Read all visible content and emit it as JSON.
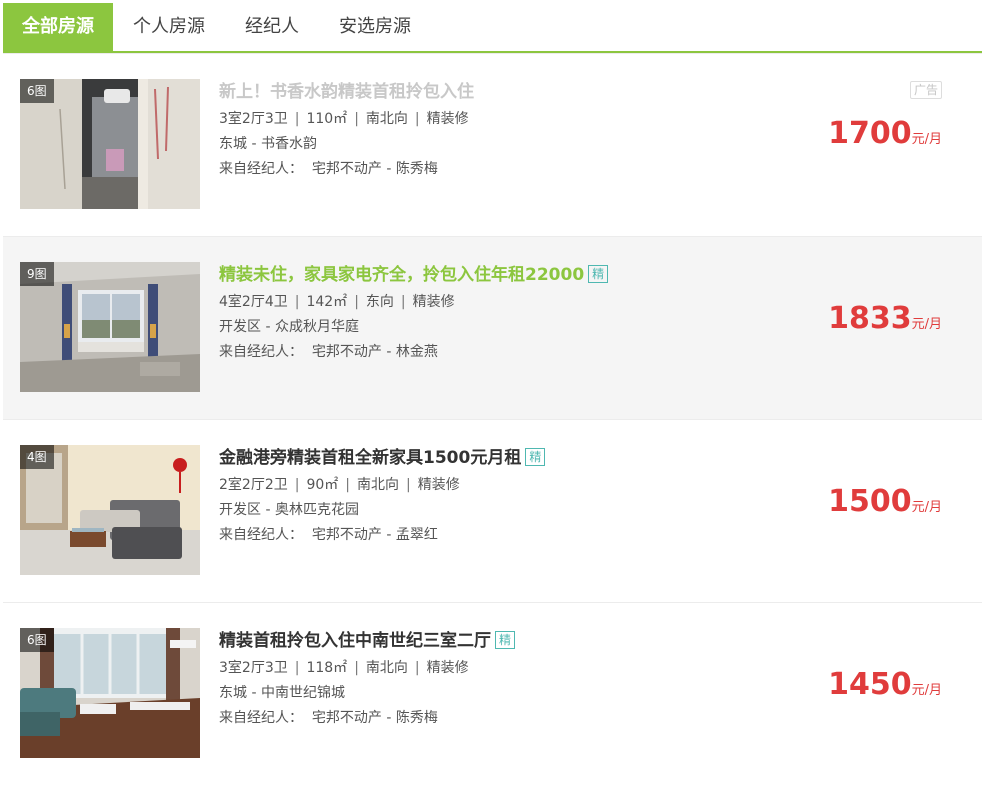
{
  "tabs": [
    {
      "label": "全部房源",
      "active": true
    },
    {
      "label": "个人房源",
      "active": false
    },
    {
      "label": "经纪人",
      "active": false
    },
    {
      "label": "安选房源",
      "active": false
    }
  ],
  "colors": {
    "accent": "#8cc63f",
    "price": "#e03c3c",
    "tag": "#4fb8b1"
  },
  "listings": [
    {
      "pic_count": "6图",
      "title": "新上！书香水韵精装首租拎包入住",
      "layout": "3室2厅3卫",
      "area": "110㎡",
      "orientation": "南北向",
      "decoration": "精装修",
      "district": "东城",
      "community": "书香水韵",
      "source_label": "来自经纪人：",
      "agency": "宅邦不动产",
      "agent": "陈秀梅",
      "ad_badge": "广告",
      "price": "1700",
      "price_unit": "元/月"
    },
    {
      "pic_count": "9图",
      "title": "精装未住，家具家电齐全，拎包入住年租22000",
      "tag": "精",
      "layout": "4室2厅4卫",
      "area": "142㎡",
      "orientation": "东向",
      "decoration": "精装修",
      "district": "开发区",
      "community": "众成秋月华庭",
      "source_label": "来自经纪人：",
      "agency": "宅邦不动产",
      "agent": "林金燕",
      "price": "1833",
      "price_unit": "元/月"
    },
    {
      "pic_count": "4图",
      "title": "金融港旁精装首租全新家具1500元月租",
      "tag": "精",
      "layout": "2室2厅2卫",
      "area": "90㎡",
      "orientation": "南北向",
      "decoration": "精装修",
      "district": "开发区",
      "community": "奥林匹克花园",
      "source_label": "来自经纪人：",
      "agency": "宅邦不动产",
      "agent": "孟翠红",
      "price": "1500",
      "price_unit": "元/月"
    },
    {
      "pic_count": "6图",
      "title": "精装首租拎包入住中南世纪三室二厅",
      "tag": "精",
      "layout": "3室2厅3卫",
      "area": "118㎡",
      "orientation": "南北向",
      "decoration": "精装修",
      "district": "东城",
      "community": "中南世纪锦城",
      "source_label": "来自经纪人：",
      "agency": "宅邦不动产",
      "agent": "陈秀梅",
      "price": "1450",
      "price_unit": "元/月"
    }
  ]
}
